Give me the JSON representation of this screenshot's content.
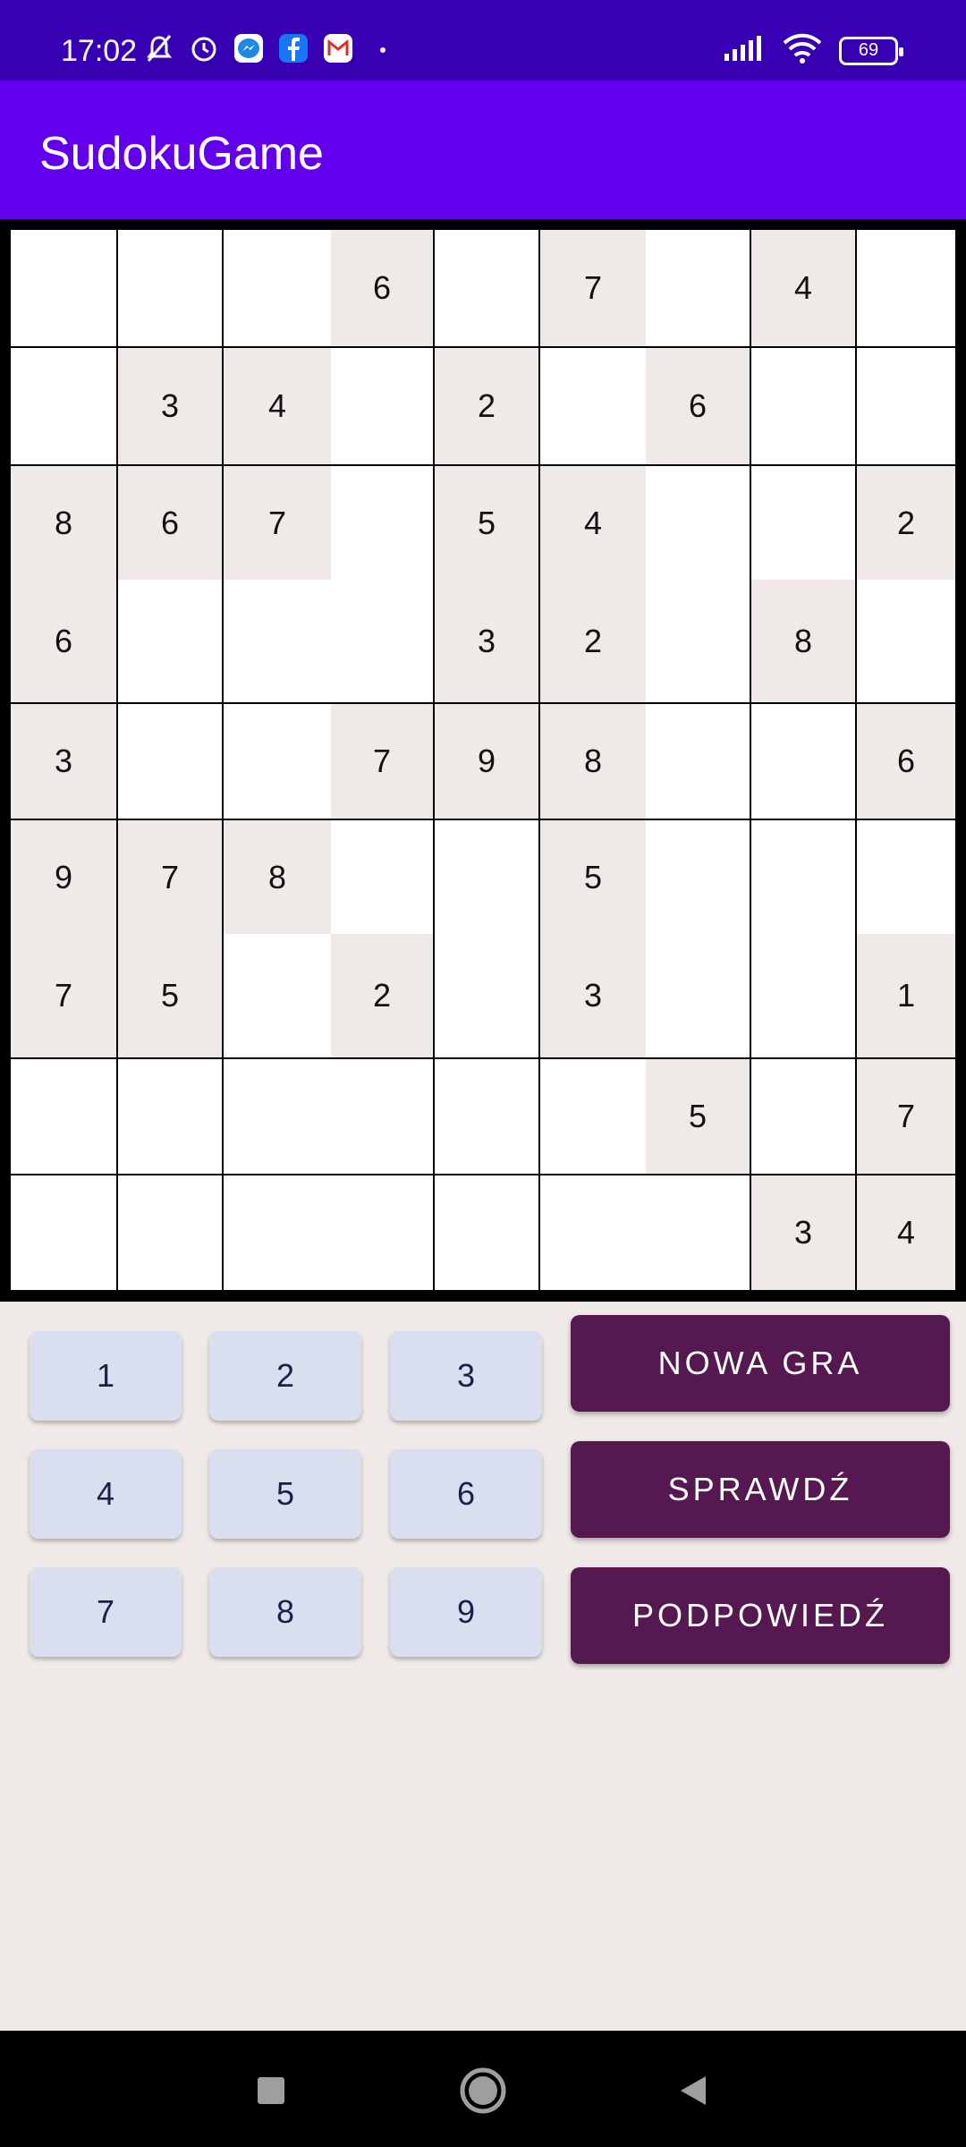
{
  "status_bar": {
    "time": "17:02",
    "battery": "69",
    "left_icons": [
      "mute-icon",
      "alarm-icon",
      "messenger-icon",
      "facebook-icon",
      "gmail-icon",
      "dot-icon"
    ],
    "right_icons": [
      "signal-icon",
      "wifi-icon",
      "battery-icon"
    ]
  },
  "app_bar": {
    "title": "SudokuGame"
  },
  "board": {
    "rows": [
      [
        "",
        "",
        "",
        "6",
        "",
        "7",
        "",
        "4",
        ""
      ],
      [
        "",
        "3",
        "4",
        "",
        "2",
        "",
        "6",
        "",
        ""
      ],
      [
        "8",
        "6",
        "7",
        "",
        "5",
        "4",
        "",
        "",
        "2"
      ],
      [
        "6",
        "",
        "",
        "",
        "3",
        "2",
        "",
        "8",
        ""
      ],
      [
        "3",
        "",
        "",
        "7",
        "9",
        "8",
        "",
        "",
        "6"
      ],
      [
        "9",
        "7",
        "8",
        "",
        "",
        "5",
        "",
        "",
        ""
      ],
      [
        "7",
        "5",
        "",
        "2",
        "",
        "3",
        "",
        "",
        "1"
      ],
      [
        "",
        "",
        "",
        "",
        "",
        "",
        "5",
        "",
        "7"
      ],
      [
        "",
        "",
        "",
        "",
        "",
        "",
        "",
        "3",
        "4"
      ]
    ],
    "colors": {
      "given": "#efe9e7",
      "empty": "#ffffff",
      "border": "#000000"
    }
  },
  "keypad": {
    "numbers": [
      "1",
      "2",
      "3",
      "4",
      "5",
      "6",
      "7",
      "8",
      "9"
    ]
  },
  "actions": {
    "new_game": "NOWA GRA",
    "check": "SPRAWDŹ",
    "hint": "PODPOWIEDŹ"
  },
  "colors": {
    "status_bar": "#3700b3",
    "app_bar": "#6200ee",
    "action_button": "#561851",
    "number_button": "#dadff0",
    "background": "#efe9e7"
  },
  "nav_bar": {
    "buttons": [
      "recents-icon",
      "home-icon",
      "back-icon"
    ]
  }
}
